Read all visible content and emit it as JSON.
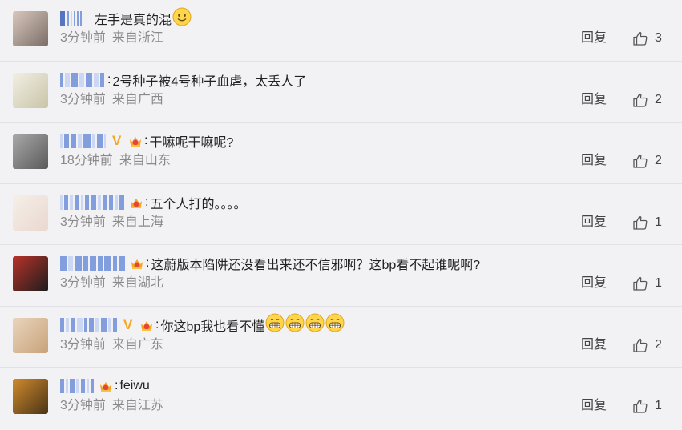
{
  "comments": [
    {
      "text": "左手是真的混",
      "time": "3分钟前",
      "location": "来自浙江",
      "reply": "回复",
      "likes": "3",
      "emoji_count": 1,
      "emoji_kind": "smile",
      "has_v": false,
      "has_crown": false,
      "has_colon": false,
      "avatar_colors": [
        "#7a6e66",
        "#d9c7bd"
      ]
    },
    {
      "text": "2号种子被4号种子血虐，太丢人了",
      "time": "3分钟前",
      "location": "来自广西",
      "reply": "回复",
      "likes": "2",
      "emoji_count": 0,
      "emoji_kind": "",
      "has_v": false,
      "has_crown": false,
      "has_colon": true,
      "avatar_colors": [
        "#c9c4a8",
        "#f1efe3"
      ]
    },
    {
      "text": "干嘛呢干嘛呢?",
      "time": "18分钟前",
      "location": "来自山东",
      "reply": "回复",
      "likes": "2",
      "emoji_count": 0,
      "emoji_kind": "",
      "has_v": true,
      "has_crown": true,
      "has_colon": true,
      "avatar_colors": [
        "#5a5a5a",
        "#a9a9a9"
      ]
    },
    {
      "text": "五个人打的。。。。",
      "time": "3分钟前",
      "location": "来自上海",
      "reply": "回复",
      "likes": "1",
      "emoji_count": 0,
      "emoji_kind": "",
      "has_v": false,
      "has_crown": true,
      "has_colon": true,
      "avatar_colors": [
        "#e9d8cf",
        "#f6efe9"
      ]
    },
    {
      "text": "这蔚版本陷阱还没看出来还不信邪啊？这bp看不起谁呢啊?",
      "time": "3分钟前",
      "location": "来自湖北",
      "reply": "回复",
      "likes": "1",
      "emoji_count": 0,
      "emoji_kind": "",
      "has_v": false,
      "has_crown": true,
      "has_colon": true,
      "avatar_colors": [
        "#1d1d1d",
        "#b8322a"
      ]
    },
    {
      "text": "你这bp我也看不懂",
      "time": "3分钟前",
      "location": "来自广东",
      "reply": "回复",
      "likes": "2",
      "emoji_count": 4,
      "emoji_kind": "grin",
      "has_v": true,
      "has_crown": true,
      "has_colon": true,
      "avatar_colors": [
        "#c8a27a",
        "#e9d5bd"
      ]
    },
    {
      "text": "feiwu",
      "time": "3分钟前",
      "location": "来自江苏",
      "reply": "回复",
      "likes": "1",
      "emoji_count": 0,
      "emoji_kind": "",
      "has_v": false,
      "has_crown": true,
      "has_colon": true,
      "avatar_colors": [
        "#4a3418",
        "#d08a2c"
      ]
    }
  ]
}
